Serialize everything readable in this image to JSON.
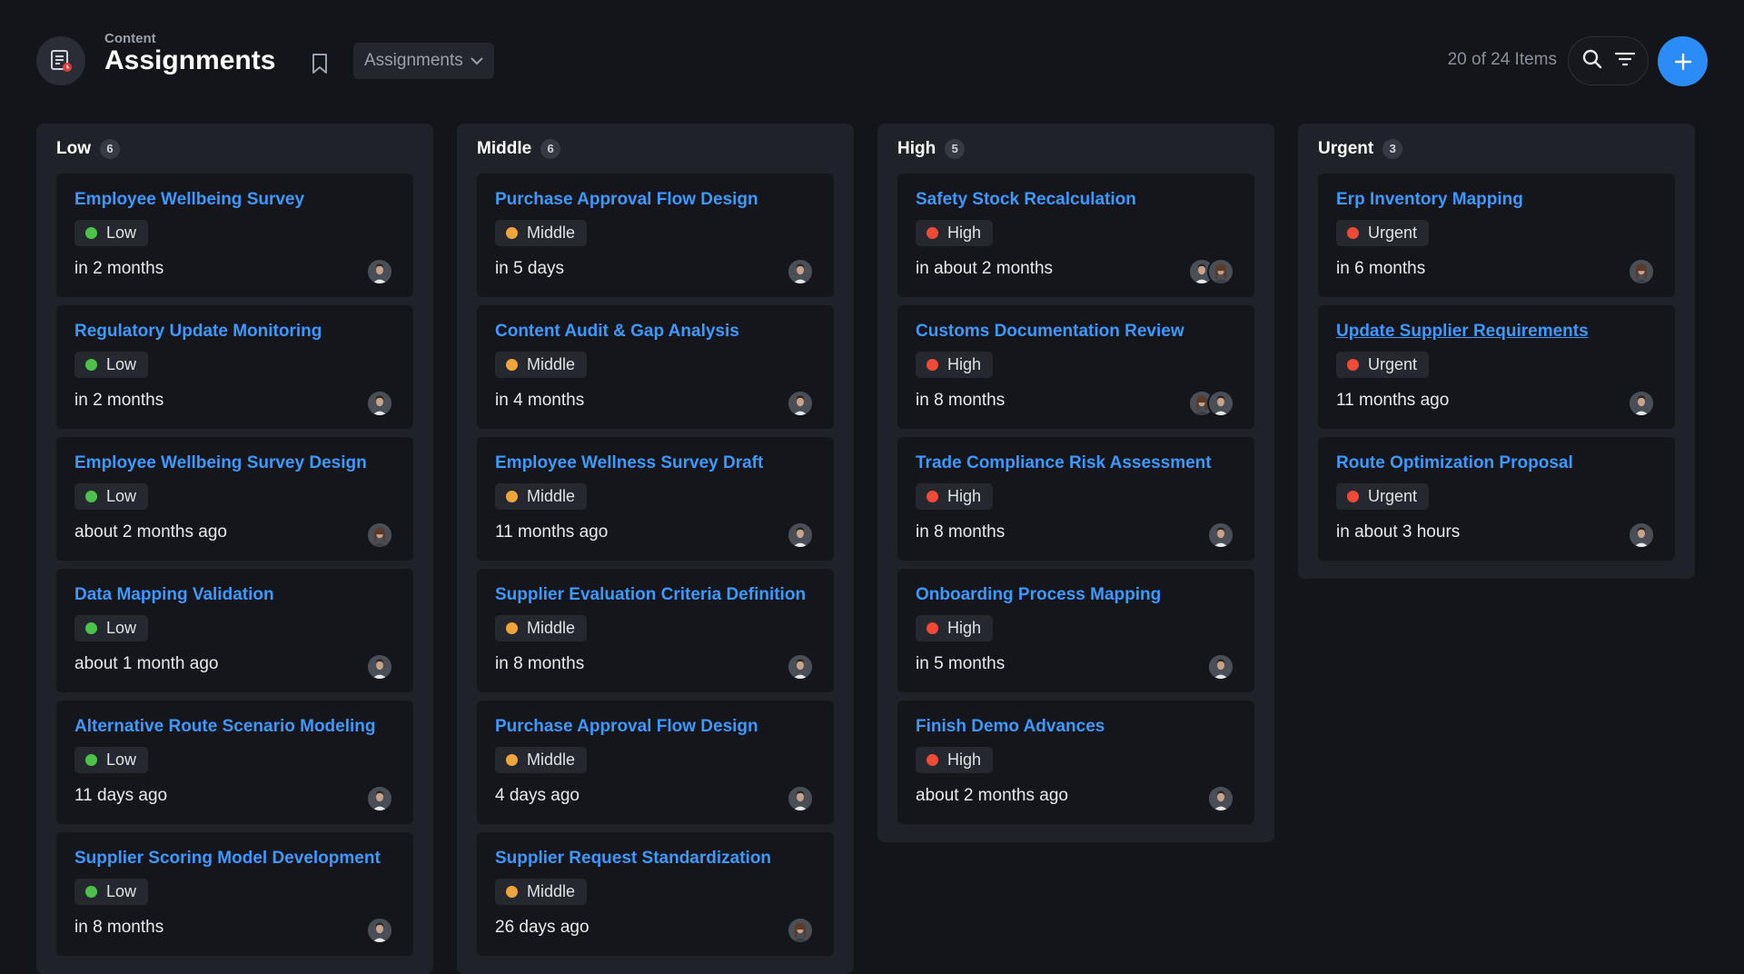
{
  "header": {
    "breadcrumb": "Content",
    "title": "Assignments",
    "view_select": "Assignments",
    "item_count": "20 of 24 Items"
  },
  "colors": {
    "background": "#13151a",
    "column": "#1f2229",
    "card": "#14161b",
    "link": "#3d98ff",
    "accent": "#2b8cf7",
    "low": "#4cc24a",
    "middle": "#f0a53a",
    "high": "#f24a36",
    "urgent": "#f24a36"
  },
  "columns": [
    {
      "name": "Low",
      "count": "6",
      "cards": [
        {
          "title": "Employee Wellbeing Survey",
          "priority": "Low",
          "due": "in 2 months",
          "avatars": [
            "man"
          ]
        },
        {
          "title": "Regulatory Update Monitoring",
          "priority": "Low",
          "due": "in 2 months",
          "avatars": [
            "man"
          ]
        },
        {
          "title": "Employee Wellbeing Survey Design",
          "priority": "Low",
          "due": "about 2 months ago",
          "avatars": [
            "woman"
          ]
        },
        {
          "title": "Data Mapping Validation",
          "priority": "Low",
          "due": "about 1 month ago",
          "avatars": [
            "man"
          ]
        },
        {
          "title": "Alternative Route Scenario Modeling",
          "priority": "Low",
          "due": "11 days ago",
          "avatars": [
            "man"
          ]
        },
        {
          "title": "Supplier Scoring Model Development",
          "priority": "Low",
          "due": "in 8 months",
          "avatars": [
            "man"
          ]
        }
      ]
    },
    {
      "name": "Middle",
      "count": "6",
      "cards": [
        {
          "title": "Purchase Approval Flow Design",
          "priority": "Middle",
          "due": "in 5 days",
          "avatars": [
            "man"
          ]
        },
        {
          "title": "Content Audit & Gap Analysis",
          "priority": "Middle",
          "due": "in 4 months",
          "avatars": [
            "man"
          ]
        },
        {
          "title": "Employee Wellness Survey Draft",
          "priority": "Middle",
          "due": "11 months ago",
          "avatars": [
            "man"
          ]
        },
        {
          "title": "Supplier Evaluation Criteria Definition",
          "priority": "Middle",
          "due": "in 8 months",
          "avatars": [
            "man"
          ]
        },
        {
          "title": "Purchase Approval Flow Design",
          "priority": "Middle",
          "due": "4 days ago",
          "avatars": [
            "man"
          ]
        },
        {
          "title": "Supplier Request Standardization",
          "priority": "Middle",
          "due": "26 days ago",
          "avatars": [
            "woman"
          ]
        }
      ]
    },
    {
      "name": "High",
      "count": "5",
      "cards": [
        {
          "title": "Safety Stock Recalculation",
          "priority": "High",
          "due": "in about 2 months",
          "avatars": [
            "man",
            "woman"
          ]
        },
        {
          "title": "Customs Documentation Review",
          "priority": "High",
          "due": "in 8 months",
          "avatars": [
            "woman",
            "man"
          ]
        },
        {
          "title": "Trade Compliance Risk Assessment",
          "priority": "High",
          "due": "in 8 months",
          "avatars": [
            "man"
          ]
        },
        {
          "title": "Onboarding Process Mapping",
          "priority": "High",
          "due": "in 5 months",
          "avatars": [
            "man"
          ]
        },
        {
          "title": "Finish Demo Advances",
          "priority": "High",
          "due": "about 2 months ago",
          "avatars": [
            "man"
          ]
        }
      ]
    },
    {
      "name": "Urgent",
      "count": "3",
      "cards": [
        {
          "title": "Erp Inventory Mapping",
          "priority": "Urgent",
          "due": "in 6 months",
          "avatars": [
            "woman"
          ]
        },
        {
          "title": "Update Supplier Requirements",
          "priority": "Urgent",
          "due": "11 months ago",
          "avatars": [
            "man"
          ],
          "hovered": true
        },
        {
          "title": "Route Optimization Proposal",
          "priority": "Urgent",
          "due": "in about 3 hours",
          "avatars": [
            "man"
          ]
        }
      ]
    }
  ]
}
